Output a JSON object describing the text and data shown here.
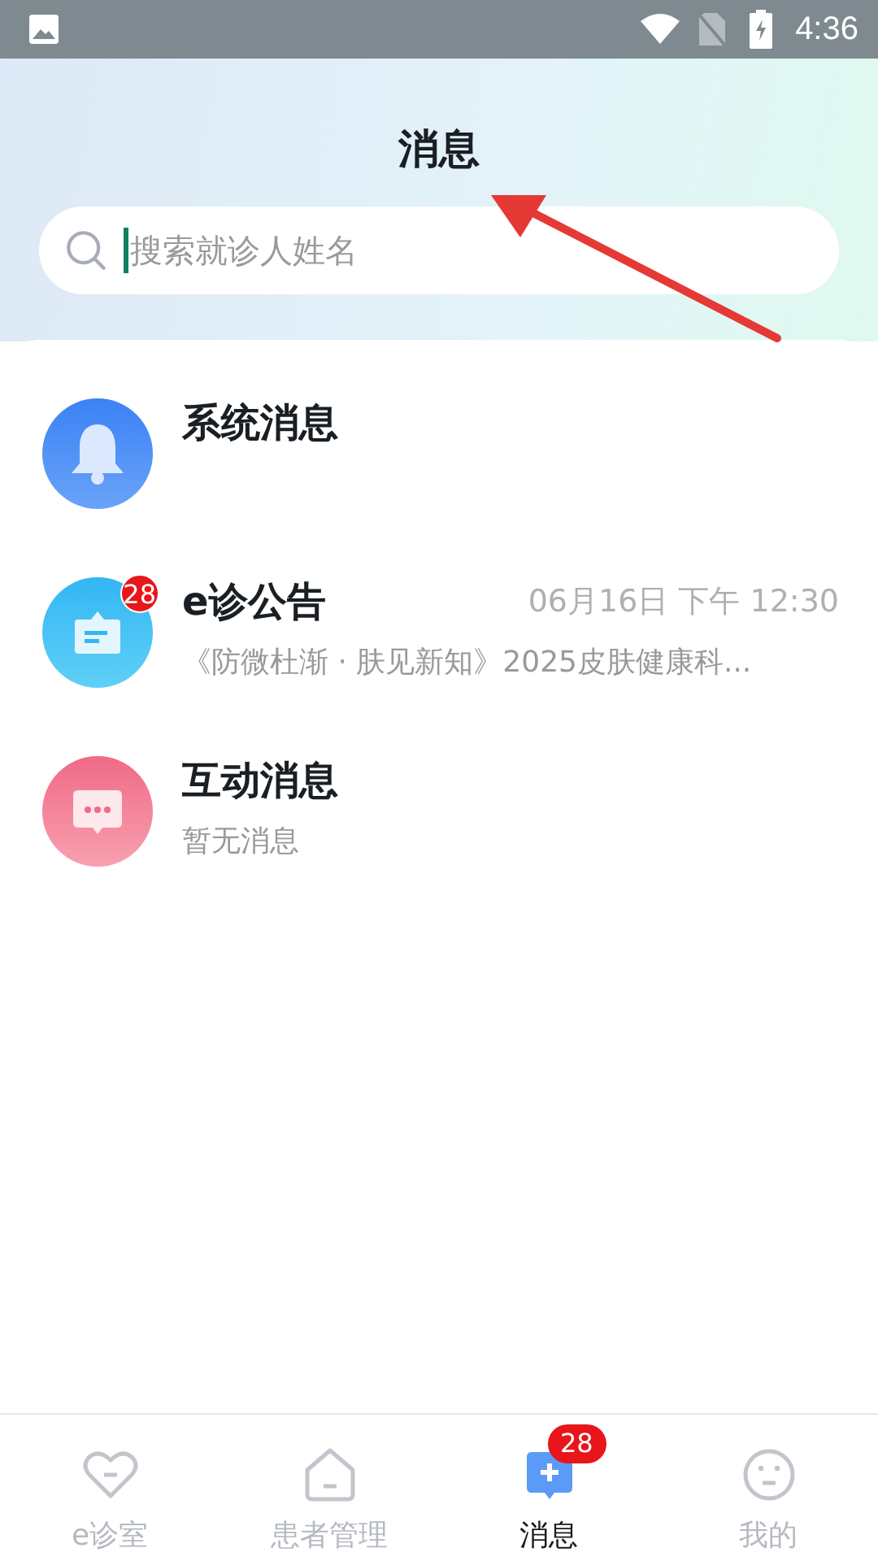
{
  "status_bar": {
    "time": "4:36"
  },
  "header": {
    "title": "消息"
  },
  "search": {
    "placeholder": "搜索就诊人姓名"
  },
  "messages": [
    {
      "kind": "bell",
      "title": "系统消息"
    },
    {
      "kind": "notice",
      "title": "e诊公告",
      "badge": "28",
      "time": "06月16日 下午 12:30",
      "preview": "《防微杜渐 · 肤见新知》2025皮肤健康科..."
    },
    {
      "kind": "chat",
      "title": "互动消息",
      "preview": "暂无消息"
    }
  ],
  "tabs": [
    {
      "kind": "heart",
      "label": "e诊室",
      "selected": false
    },
    {
      "kind": "house",
      "label": "患者管理",
      "selected": false
    },
    {
      "kind": "message",
      "label": "消息",
      "selected": true,
      "badge": "28"
    },
    {
      "kind": "face",
      "label": "我的",
      "selected": false
    }
  ]
}
